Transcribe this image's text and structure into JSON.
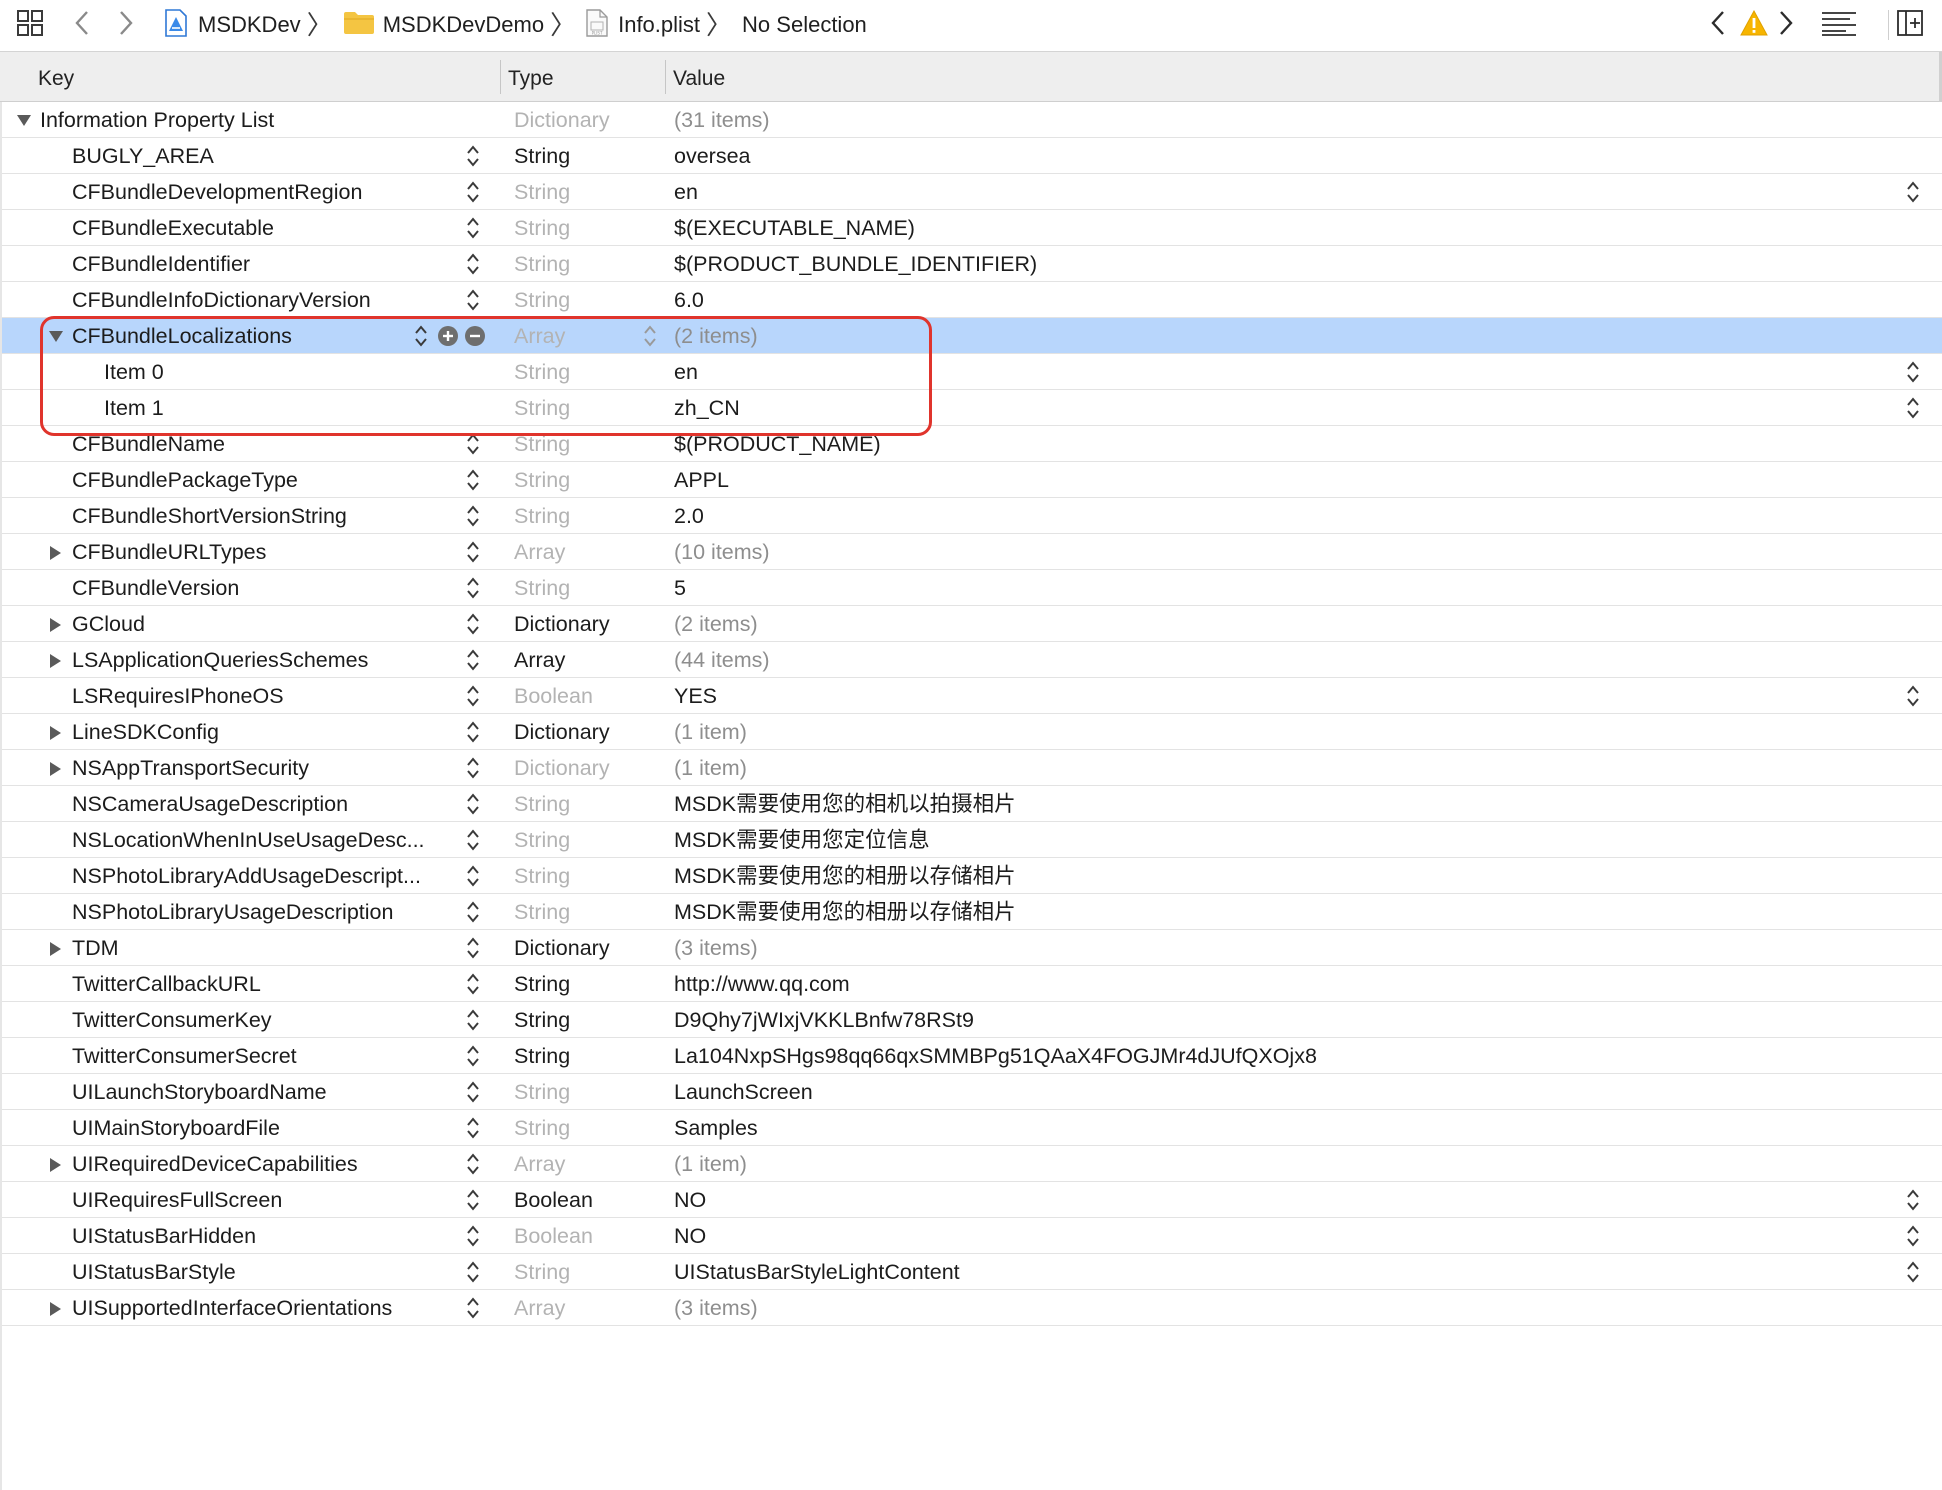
{
  "breadcrumb": {
    "project": "MSDKDev",
    "folder": "MSDKDevDemo",
    "file": "Info.plist",
    "selection": "No Selection"
  },
  "icons": {
    "related_items": "grid-icon",
    "back": "chevron-left-icon",
    "forward": "chevron-right-icon",
    "project": "xcode-project-icon",
    "folder": "folder-icon",
    "plist": "plist-file-icon",
    "warning": "warning-icon",
    "minimap": "editor-options-icon",
    "add_editor": "add-editor-icon"
  },
  "columns": {
    "key": "Key",
    "type": "Type",
    "value": "Value"
  },
  "colors": {
    "selection": "#b8d6fc",
    "highlight_box": "#e0342c",
    "warning": "#f7b500"
  },
  "rows": [
    {
      "key": "Information Property List",
      "type": "Dictionary",
      "value": "(31 items)",
      "level": 0,
      "disclosure": "open",
      "type_dim": true,
      "value_dim": true,
      "stepper": false
    },
    {
      "key": "BUGLY_AREA",
      "type": "String",
      "value": "oversea",
      "level": 1,
      "disclosure": "none",
      "type_dim": false,
      "value_dim": false,
      "stepper": true
    },
    {
      "key": "CFBundleDevelopmentRegion",
      "type": "String",
      "value": "en",
      "level": 1,
      "disclosure": "none",
      "type_dim": true,
      "value_dim": false,
      "stepper": true,
      "value_stepper": true
    },
    {
      "key": "CFBundleExecutable",
      "type": "String",
      "value": "$(EXECUTABLE_NAME)",
      "level": 1,
      "disclosure": "none",
      "type_dim": true,
      "value_dim": false,
      "stepper": true
    },
    {
      "key": "CFBundleIdentifier",
      "type": "String",
      "value": "$(PRODUCT_BUNDLE_IDENTIFIER)",
      "level": 1,
      "disclosure": "none",
      "type_dim": true,
      "value_dim": false,
      "stepper": true
    },
    {
      "key": "CFBundleInfoDictionaryVersion",
      "type": "String",
      "value": "6.0",
      "level": 1,
      "disclosure": "none",
      "type_dim": true,
      "value_dim": false,
      "stepper": true
    },
    {
      "key": "CFBundleLocalizations",
      "type": "Array",
      "value": "(2 items)",
      "level": 1,
      "disclosure": "open",
      "type_dim": true,
      "value_dim": true,
      "stepper": true,
      "selected": true,
      "row_buttons": true,
      "type_stepper": true
    },
    {
      "key": "Item 0",
      "type": "String",
      "value": "en",
      "level": 2,
      "disclosure": "none",
      "type_dim": true,
      "value_dim": false,
      "stepper": false,
      "value_stepper": true
    },
    {
      "key": "Item 1",
      "type": "String",
      "value": "zh_CN",
      "level": 2,
      "disclosure": "none",
      "type_dim": true,
      "value_dim": false,
      "stepper": false,
      "value_stepper": true
    },
    {
      "key": "CFBundleName",
      "type": "String",
      "value": "$(PRODUCT_NAME)",
      "level": 1,
      "disclosure": "none",
      "type_dim": true,
      "value_dim": false,
      "stepper": true
    },
    {
      "key": "CFBundlePackageType",
      "type": "String",
      "value": "APPL",
      "level": 1,
      "disclosure": "none",
      "type_dim": true,
      "value_dim": false,
      "stepper": true
    },
    {
      "key": "CFBundleShortVersionString",
      "type": "String",
      "value": "2.0",
      "level": 1,
      "disclosure": "none",
      "type_dim": true,
      "value_dim": false,
      "stepper": true
    },
    {
      "key": "CFBundleURLTypes",
      "type": "Array",
      "value": "(10 items)",
      "level": 1,
      "disclosure": "closed",
      "type_dim": true,
      "value_dim": true,
      "stepper": true
    },
    {
      "key": "CFBundleVersion",
      "type": "String",
      "value": "5",
      "level": 1,
      "disclosure": "none",
      "type_dim": true,
      "value_dim": false,
      "stepper": true
    },
    {
      "key": "GCloud",
      "type": "Dictionary",
      "value": "(2 items)",
      "level": 1,
      "disclosure": "closed",
      "type_dim": false,
      "value_dim": true,
      "stepper": true
    },
    {
      "key": "LSApplicationQueriesSchemes",
      "type": "Array",
      "value": "(44 items)",
      "level": 1,
      "disclosure": "closed",
      "type_dim": false,
      "value_dim": true,
      "stepper": true
    },
    {
      "key": "LSRequiresIPhoneOS",
      "type": "Boolean",
      "value": "YES",
      "level": 1,
      "disclosure": "none",
      "type_dim": true,
      "value_dim": false,
      "stepper": true,
      "value_stepper": true
    },
    {
      "key": "LineSDKConfig",
      "type": "Dictionary",
      "value": "(1 item)",
      "level": 1,
      "disclosure": "closed",
      "type_dim": false,
      "value_dim": true,
      "stepper": true
    },
    {
      "key": "NSAppTransportSecurity",
      "type": "Dictionary",
      "value": "(1 item)",
      "level": 1,
      "disclosure": "closed",
      "type_dim": true,
      "value_dim": true,
      "stepper": true
    },
    {
      "key": "NSCameraUsageDescription",
      "type": "String",
      "value": "MSDK需要使用您的相机以拍摄相片",
      "level": 1,
      "disclosure": "none",
      "type_dim": true,
      "value_dim": false,
      "stepper": true
    },
    {
      "key": "NSLocationWhenInUseUsageDesc...",
      "type": "String",
      "value": "MSDK需要使用您定位信息",
      "level": 1,
      "disclosure": "none",
      "type_dim": true,
      "value_dim": false,
      "stepper": true
    },
    {
      "key": "NSPhotoLibraryAddUsageDescript...",
      "type": "String",
      "value": "MSDK需要使用您的相册以存储相片",
      "level": 1,
      "disclosure": "none",
      "type_dim": true,
      "value_dim": false,
      "stepper": true
    },
    {
      "key": "NSPhotoLibraryUsageDescription",
      "type": "String",
      "value": "MSDK需要使用您的相册以存储相片",
      "level": 1,
      "disclosure": "none",
      "type_dim": true,
      "value_dim": false,
      "stepper": true
    },
    {
      "key": "TDM",
      "type": "Dictionary",
      "value": "(3 items)",
      "level": 1,
      "disclosure": "closed",
      "type_dim": false,
      "value_dim": true,
      "stepper": true
    },
    {
      "key": "TwitterCallbackURL",
      "type": "String",
      "value": "http://www.qq.com",
      "level": 1,
      "disclosure": "none",
      "type_dim": false,
      "value_dim": false,
      "stepper": true
    },
    {
      "key": "TwitterConsumerKey",
      "type": "String",
      "value": "D9Qhy7jWIxjVKKLBnfw78RSt9",
      "level": 1,
      "disclosure": "none",
      "type_dim": false,
      "value_dim": false,
      "stepper": true
    },
    {
      "key": "TwitterConsumerSecret",
      "type": "String",
      "value": "La104NxpSHgs98qq66qxSMMBPg51QAaX4FOGJMr4dJUfQXOjx8",
      "level": 1,
      "disclosure": "none",
      "type_dim": false,
      "value_dim": false,
      "stepper": true
    },
    {
      "key": "UILaunchStoryboardName",
      "type": "String",
      "value": "LaunchScreen",
      "level": 1,
      "disclosure": "none",
      "type_dim": true,
      "value_dim": false,
      "stepper": true
    },
    {
      "key": "UIMainStoryboardFile",
      "type": "String",
      "value": "Samples",
      "level": 1,
      "disclosure": "none",
      "type_dim": true,
      "value_dim": false,
      "stepper": true
    },
    {
      "key": "UIRequiredDeviceCapabilities",
      "type": "Array",
      "value": "(1 item)",
      "level": 1,
      "disclosure": "closed",
      "type_dim": true,
      "value_dim": true,
      "stepper": true
    },
    {
      "key": "UIRequiresFullScreen",
      "type": "Boolean",
      "value": "NO",
      "level": 1,
      "disclosure": "none",
      "type_dim": false,
      "value_dim": false,
      "stepper": true,
      "value_stepper": true
    },
    {
      "key": "UIStatusBarHidden",
      "type": "Boolean",
      "value": "NO",
      "level": 1,
      "disclosure": "none",
      "type_dim": true,
      "value_dim": false,
      "stepper": true,
      "value_stepper": true
    },
    {
      "key": "UIStatusBarStyle",
      "type": "String",
      "value": "UIStatusBarStyleLightContent",
      "level": 1,
      "disclosure": "none",
      "type_dim": true,
      "value_dim": false,
      "stepper": true,
      "value_stepper": true
    },
    {
      "key": "UISupportedInterfaceOrientations",
      "type": "Array",
      "value": "(3 items)",
      "level": 1,
      "disclosure": "closed",
      "type_dim": true,
      "value_dim": true,
      "stepper": true
    }
  ]
}
